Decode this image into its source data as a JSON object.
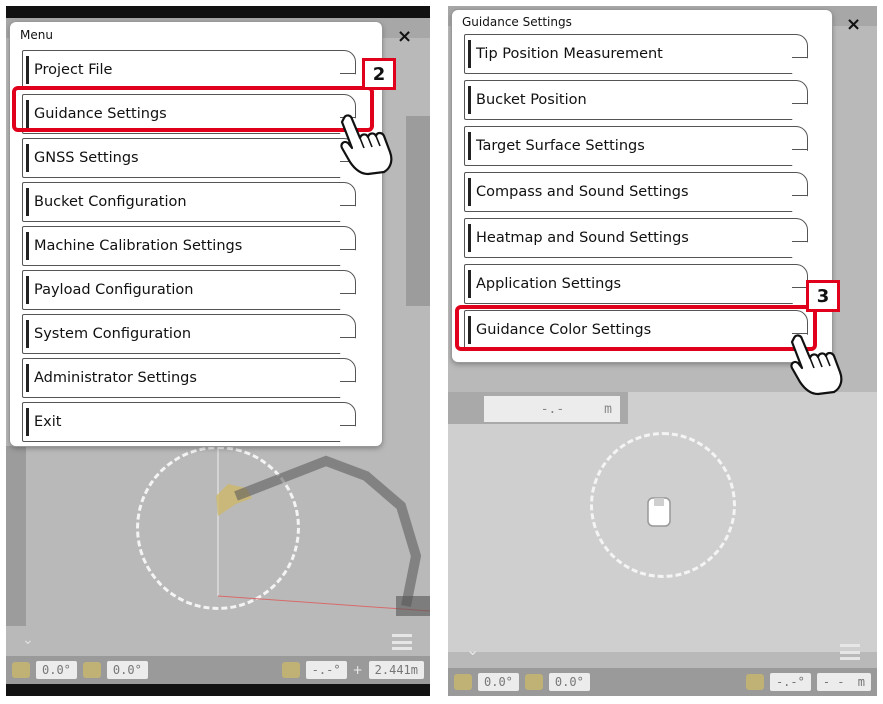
{
  "step2": {
    "badge": "2",
    "menu": {
      "title": "Menu",
      "close": "×",
      "items": [
        {
          "label": "Project File"
        },
        {
          "label": "Guidance Settings"
        },
        {
          "label": "GNSS Settings"
        },
        {
          "label": "Bucket Configuration"
        },
        {
          "label": "Machine Calibration Settings"
        },
        {
          "label": "Payload Configuration"
        },
        {
          "label": "System Configuration"
        },
        {
          "label": "Administrator Settings"
        },
        {
          "label": "Exit"
        }
      ]
    },
    "status": {
      "pitch": "0.0°",
      "roll": "0.0°",
      "value1": "-.-°",
      "plus": "+",
      "distance": "2.441m"
    }
  },
  "step3": {
    "badge": "3",
    "menu": {
      "title": "Guidance Settings",
      "close": "×",
      "items": [
        {
          "label": "Tip Position Measurement"
        },
        {
          "label": "Bucket Position"
        },
        {
          "label": "Target Surface Settings"
        },
        {
          "label": "Compass and Sound Settings"
        },
        {
          "label": "Heatmap and Sound Settings"
        },
        {
          "label": "Application Settings"
        },
        {
          "label": "Guidance Color Settings"
        }
      ]
    },
    "readout": {
      "value": "-.-",
      "unit": "m"
    },
    "status": {
      "pitch": "0.0°",
      "roll": "0.0°",
      "value1": "-.-°",
      "value2": "- -",
      "unit": "m"
    }
  },
  "colors": {
    "highlight": "#e0001b",
    "dim_background": "#b9b9b9",
    "menu_background": "#ffffff"
  },
  "icons": [
    "close-icon",
    "hand-pointer-icon",
    "hamburger-menu-icon",
    "chevron-down-icon",
    "excavator-icon"
  ]
}
